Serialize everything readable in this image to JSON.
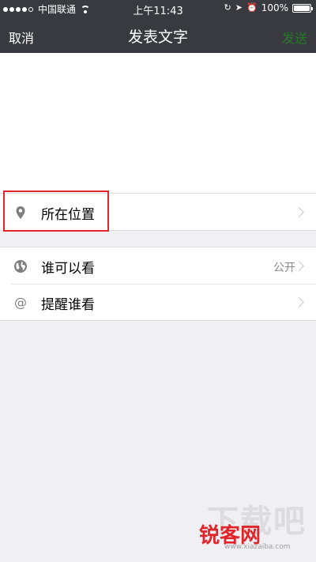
{
  "status_bar": {
    "carrier": "中国联通",
    "time": "上午11:43",
    "battery": "100%",
    "signal_dots_filled": 4,
    "signal_dots_total": 5
  },
  "nav": {
    "cancel": "取消",
    "title": "发表文字",
    "send": "发送"
  },
  "compose": {
    "value": ""
  },
  "options": {
    "location": {
      "label": "所在位置",
      "icon": "location-pin-icon"
    },
    "visibility": {
      "label": "谁可以看",
      "value": "公开",
      "icon": "globe-icon"
    },
    "mention": {
      "label": "提醒谁看",
      "icon": "at-icon"
    }
  },
  "watermark": {
    "top": "下载吧",
    "bottom": "锐客网",
    "url": "www.xiazaiba.com"
  },
  "colors": {
    "nav_bg": "#393a3f",
    "send_green": "#1aad19",
    "highlight_red": "#e0262a",
    "page_bg": "#efeff4"
  }
}
